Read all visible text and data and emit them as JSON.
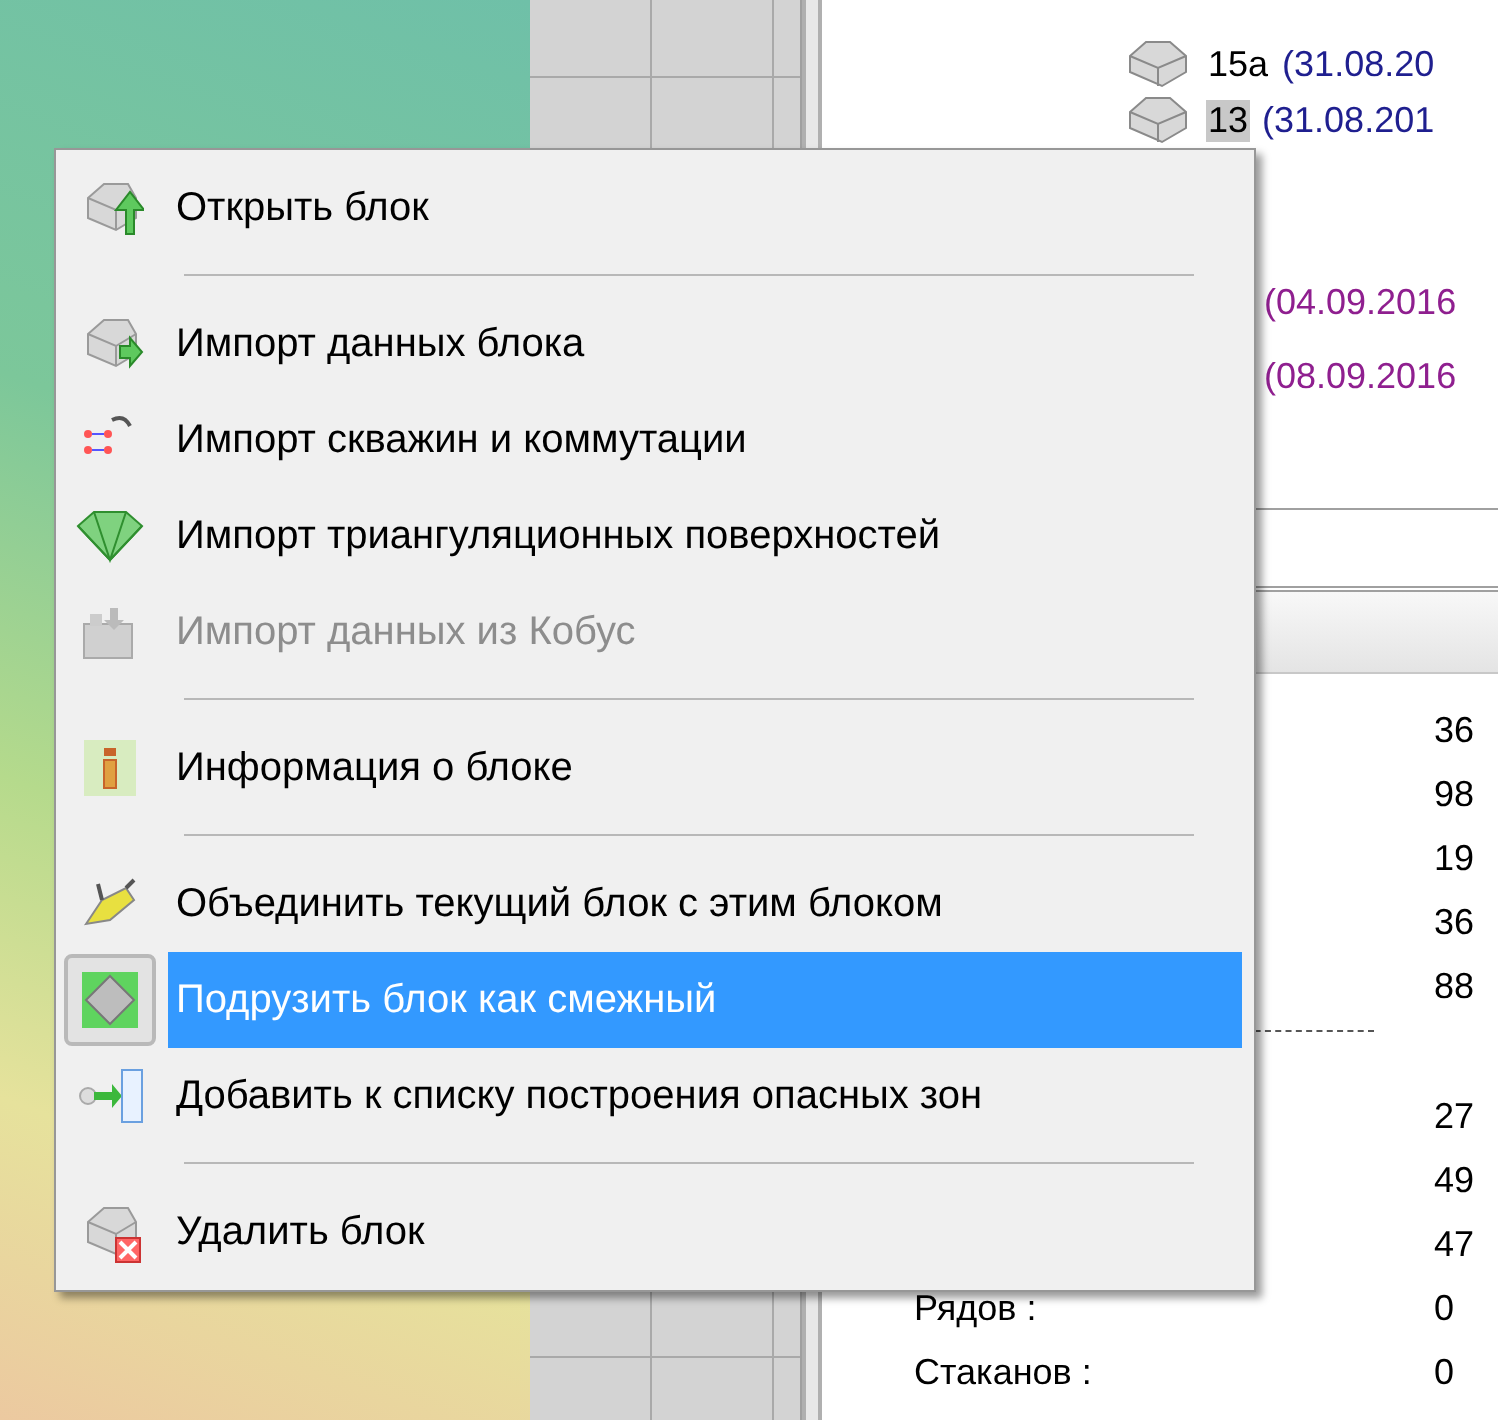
{
  "tree": [
    {
      "label": "15а",
      "date": "(31.08.20",
      "selected": false,
      "color": "#1f1f8f"
    },
    {
      "label": "13",
      "date": "(31.08.201",
      "selected": true,
      "color": "#1f1f8f"
    },
    {
      "date": "(04.09.2016",
      "selected": false,
      "color": "#8f1f8f"
    },
    {
      "date": "(08.09.2016",
      "selected": false,
      "color": "#8f1f8f"
    }
  ],
  "properties": [
    {
      "value": "36"
    },
    {
      "value": "98"
    },
    {
      "value": "19"
    },
    {
      "value": "36"
    },
    {
      "value": "88"
    },
    {
      "kind": "divider"
    },
    {
      "value": "27"
    },
    {
      "value": "49"
    },
    {
      "value": "47"
    },
    {
      "label": "Рядов :",
      "value": "0"
    },
    {
      "label": "Стаканов :",
      "value": "0"
    }
  ],
  "context_menu": [
    {
      "kind": "item",
      "label": "Открыть блок",
      "disabled": false,
      "selected": false
    },
    {
      "kind": "separator"
    },
    {
      "kind": "item",
      "label": "Импорт данных блока",
      "disabled": false,
      "selected": false
    },
    {
      "kind": "item",
      "label": "Импорт скважин и коммутации",
      "disabled": false,
      "selected": false
    },
    {
      "kind": "item",
      "label": "Импорт триангуляционных поверхностей",
      "disabled": false,
      "selected": false
    },
    {
      "kind": "item",
      "label": "Импорт данных из Кобус",
      "disabled": true,
      "selected": false
    },
    {
      "kind": "separator"
    },
    {
      "kind": "item",
      "label": "Информация о блоке",
      "disabled": false,
      "selected": false
    },
    {
      "kind": "separator"
    },
    {
      "kind": "item",
      "label": "Объединить текущий блок с этим блоком",
      "disabled": false,
      "selected": false
    },
    {
      "kind": "item",
      "label": "Подрузить блок как смежный",
      "disabled": false,
      "selected": true
    },
    {
      "kind": "item",
      "label": "Добавить к списку построения опасных зон",
      "disabled": false,
      "selected": false
    },
    {
      "kind": "separator"
    },
    {
      "kind": "item",
      "label": "Удалить блок",
      "disabled": false,
      "selected": false
    }
  ]
}
